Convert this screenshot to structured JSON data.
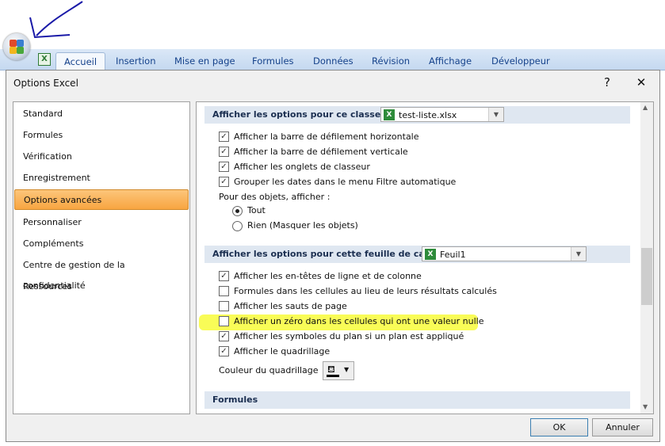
{
  "ribbon": {
    "tabs": [
      "Accueil",
      "Insertion",
      "Mise en page",
      "Formules",
      "Données",
      "Révision",
      "Affichage",
      "Développeur"
    ]
  },
  "dialog": {
    "title": "Options Excel",
    "help": "?",
    "close": "✕"
  },
  "nav": [
    "Standard",
    "Formules",
    "Vérification",
    "Enregistrement",
    "Options avancées",
    "Personnaliser",
    "Compléments",
    "Centre de gestion de la confidentialité",
    "Ressources"
  ],
  "workbook": {
    "header": "Afficher les options pour ce classeur :",
    "combo": "test-liste.xlsx",
    "options": [
      {
        "label": "Afficher la barre de défilement horizontale",
        "checked": true
      },
      {
        "label": "Afficher la barre de défilement verticale",
        "checked": true
      },
      {
        "label": "Afficher les onglets de classeur",
        "checked": true
      },
      {
        "label": "Grouper les dates dans le menu Filtre automatique",
        "checked": true
      }
    ],
    "objects_label": "Pour des objets, afficher :",
    "radios": [
      {
        "label": "Tout",
        "selected": true
      },
      {
        "label": "Rien (Masquer les objets)",
        "selected": false
      }
    ]
  },
  "sheet": {
    "header": "Afficher les options pour cette feuille de calcul :",
    "combo": "Feuil1",
    "options": [
      {
        "label": "Afficher les en-têtes de ligne et de colonne",
        "checked": true
      },
      {
        "label": "Formules dans les cellules au lieu de leurs résultats calculés",
        "checked": false
      },
      {
        "label": "Afficher les sauts de page",
        "checked": false
      },
      {
        "label": "Afficher un zéro dans les cellules qui ont une valeur nulle",
        "checked": false
      },
      {
        "label": "Afficher les symboles du plan si un plan est appliqué",
        "checked": true
      },
      {
        "label": "Afficher le quadrillage",
        "checked": true
      }
    ],
    "grid_color_label": "Couleur du quadrillage"
  },
  "formulas_header": "Formules",
  "buttons": {
    "ok": "OK",
    "cancel": "Annuler"
  },
  "colors": {
    "highlight": "#f8fb3a",
    "selected_nav": "#f8a541",
    "annotation": "#1a1aa8"
  }
}
